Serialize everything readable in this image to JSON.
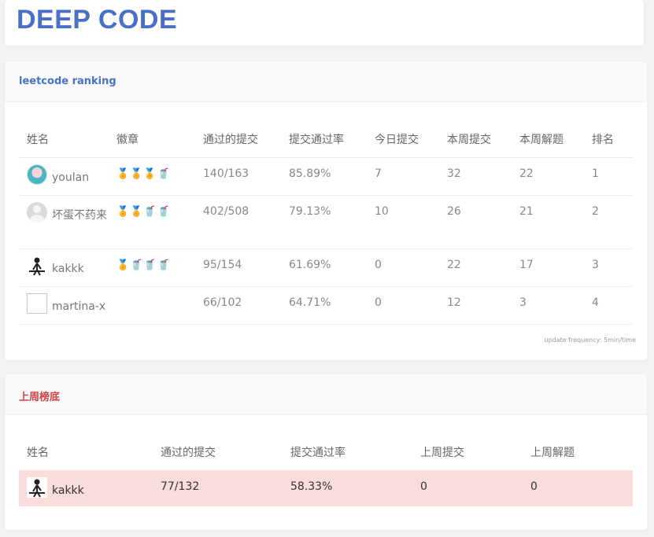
{
  "brand": {
    "title": "DEEP CODE",
    "color": "#4a6fc7"
  },
  "ranking": {
    "title": "leetcode ranking",
    "title_color": "#4a6fc7",
    "columns": [
      "姓名",
      "徽章",
      "通过的提交",
      "提交通过率",
      "今日提交",
      "本周提交",
      "本周解题",
      "排名"
    ],
    "rows": [
      {
        "name": "youlan",
        "avatar": "girl-avatar",
        "badges": [
          "medal",
          "medal",
          "medal",
          "cup"
        ],
        "passed": "140/163",
        "rate": "85.89%",
        "today": "7",
        "week_submit": "32",
        "week_solved": "22",
        "rank": "1"
      },
      {
        "name": "坏蛋不药来",
        "avatar": "default-avatar",
        "badges": [
          "medal",
          "medal",
          "cup",
          "cup"
        ],
        "passed": "402/508",
        "rate": "79.13%",
        "today": "10",
        "week_submit": "26",
        "week_solved": "21",
        "rank": "2"
      },
      {
        "name": "kakkk",
        "avatar": "sketch-avatar",
        "badges": [
          "medal",
          "cup",
          "cup",
          "cup"
        ],
        "passed": "95/154",
        "rate": "61.69%",
        "today": "0",
        "week_submit": "22",
        "week_solved": "17",
        "rank": "3"
      },
      {
        "name": "martina-x",
        "avatar": "broken-image",
        "badges": [],
        "passed": "66/102",
        "rate": "64.71%",
        "today": "0",
        "week_submit": "12",
        "week_solved": "3",
        "rank": "4"
      }
    ],
    "update_note": "update frequency: 5min/time"
  },
  "bottom": {
    "title": "上周榜底",
    "title_color": "#d23f3f",
    "columns": [
      "姓名",
      "通过的提交",
      "提交通过率",
      "上周提交",
      "上周解题"
    ],
    "row": {
      "name": "kakkk",
      "avatar": "sketch-avatar",
      "passed": "77/132",
      "rate": "58.33%",
      "last_week_submit": "0",
      "last_week_solved": "0"
    },
    "highlight_color": "#fbdcdc"
  }
}
